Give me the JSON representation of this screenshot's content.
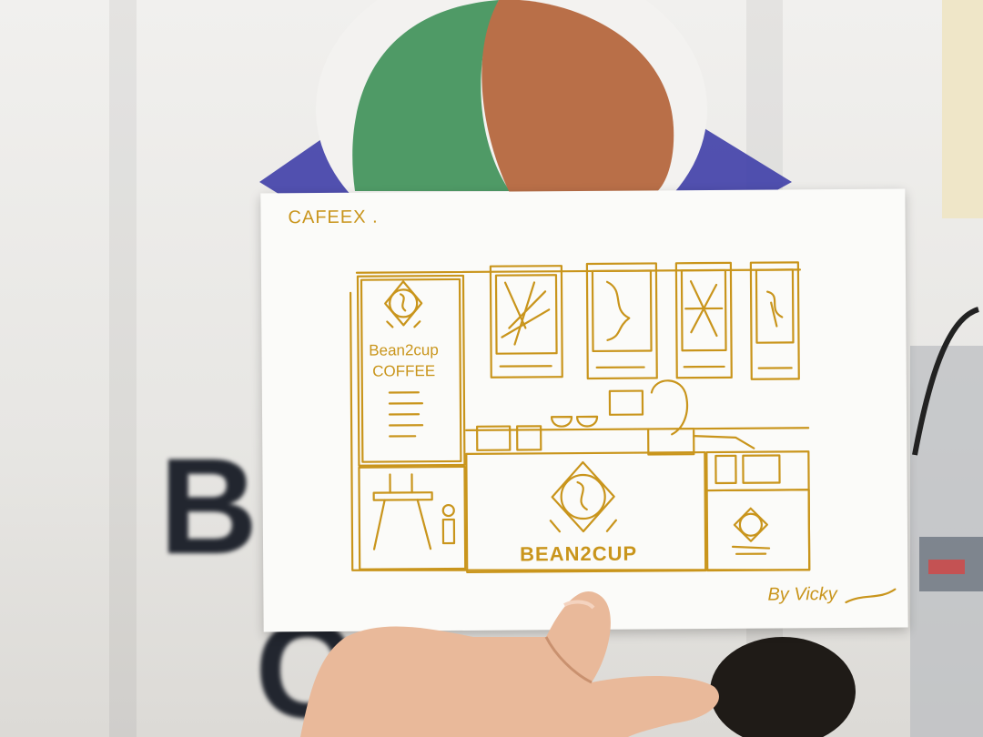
{
  "background": {
    "banner_letters_top": "BE",
    "banner_letters_bottom": "C"
  },
  "postcard": {
    "title": "CAFEEX .",
    "side_sign_line1": "Bean2cup",
    "side_sign_line2": "COFFEE",
    "counter_brand": "BEAN2CUP",
    "signature": "By Vicky",
    "ink_color": "#c9951c"
  },
  "colors": {
    "logo_green": "#4f9a66",
    "logo_brown": "#b96f48",
    "logo_purple": "#3f3fa8",
    "card": "#fbfbf9",
    "ink": "#c9951c",
    "skin": "#e9b99a"
  }
}
